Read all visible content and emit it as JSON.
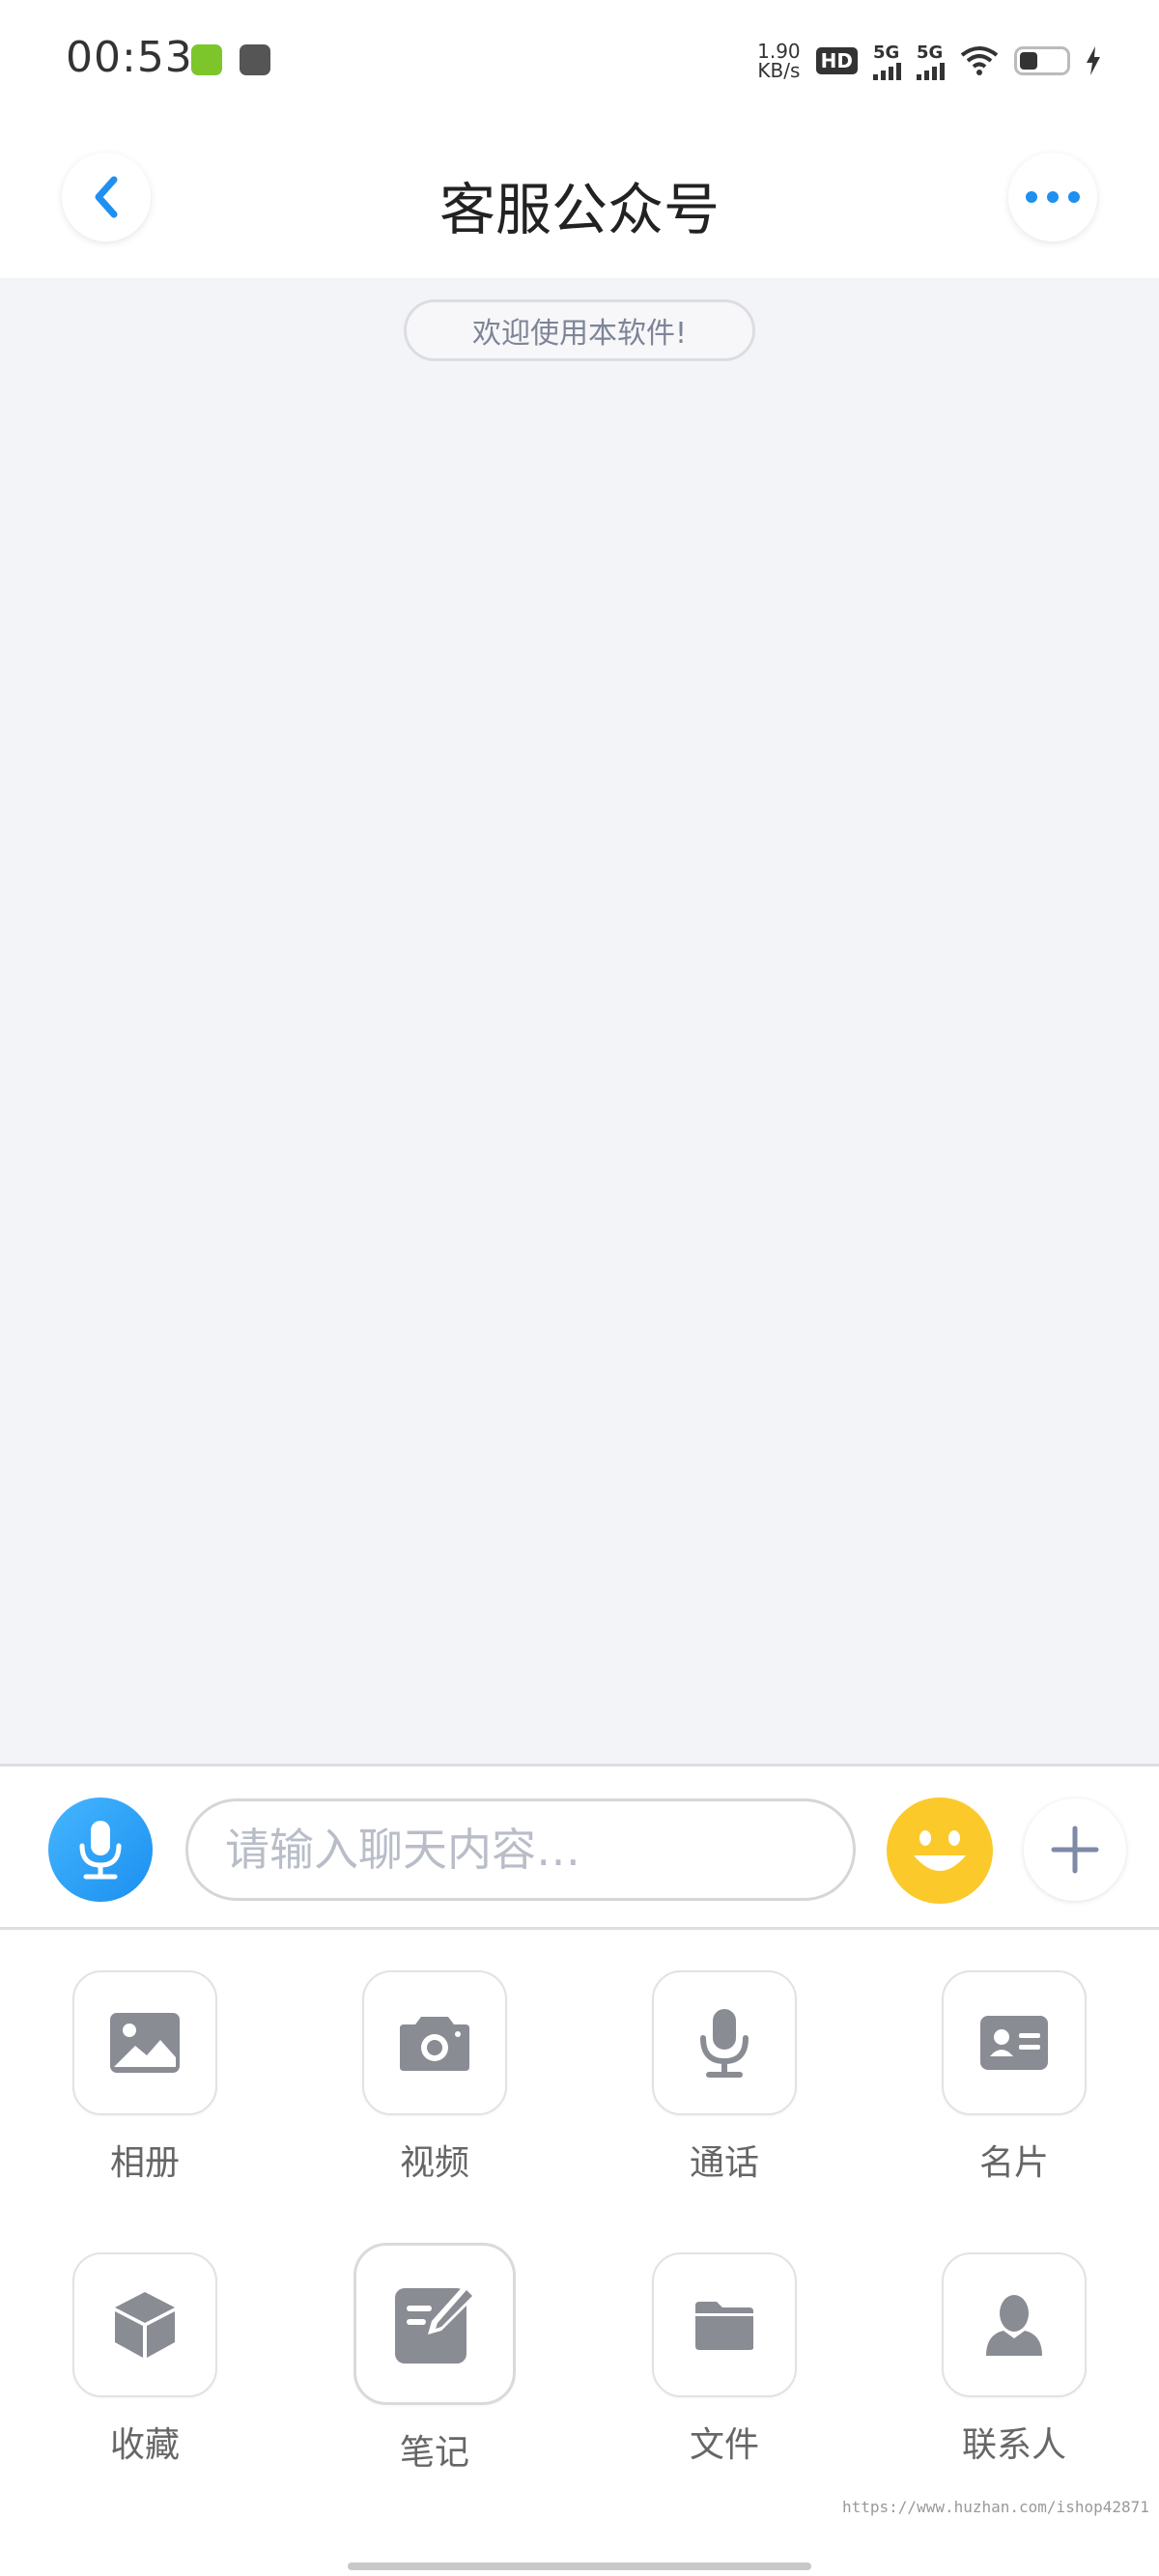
{
  "status_bar": {
    "time": "00:53",
    "net_speed_value": "1.90",
    "net_speed_unit": "KB/s",
    "hd_label": "HD",
    "sim1": "5G",
    "sim2": "5G"
  },
  "header": {
    "title": "客服公众号",
    "back_icon": "chevron-left-icon",
    "more_icon": "more-dots-icon",
    "accent_color": "#1f8ff0"
  },
  "chat": {
    "system_message": "欢迎使用本软件!"
  },
  "input_bar": {
    "placeholder": "请输入聊天内容…",
    "voice_icon": "microphone-icon",
    "emoji_icon": "smile-icon",
    "plus_icon": "plus-icon"
  },
  "tools": [
    {
      "label": "相册",
      "icon": "image-icon"
    },
    {
      "label": "视频",
      "icon": "camera-icon"
    },
    {
      "label": "通话",
      "icon": "microphone-icon"
    },
    {
      "label": "名片",
      "icon": "contact-card-icon"
    },
    {
      "label": "收藏",
      "icon": "cube-icon"
    },
    {
      "label": "笔记",
      "icon": "note-edit-icon"
    },
    {
      "label": "文件",
      "icon": "folder-icon"
    },
    {
      "label": "联系人",
      "icon": "person-icon"
    }
  ],
  "watermark": "https://www.huzhan.com/ishop42871"
}
